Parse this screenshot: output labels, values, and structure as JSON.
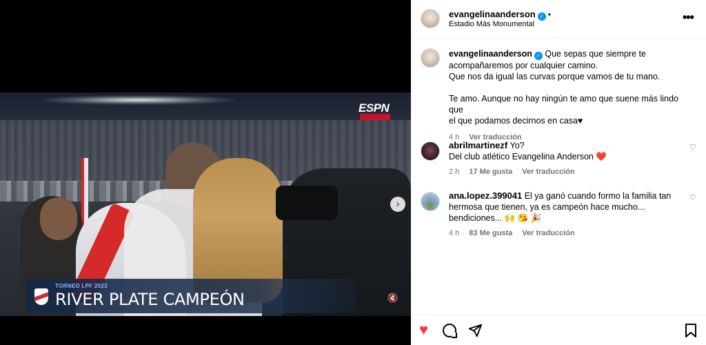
{
  "video": {
    "broadcaster": "ESPN",
    "tournament": "TORNEO LPF 2023",
    "headline": "RIVER PLATE CAMPEÓN"
  },
  "post": {
    "username": "evangelinaanderson",
    "location": "Estadio Más Monumental",
    "caption_lines": [
      "Que sepas que siempre te",
      "acompañaremos por cualquier camino.",
      "Que nos da igual las curvas porque vamos de tu mano.",
      "",
      "Te amo. Aunque no hay ningún te amo que suene más lindo que",
      "el que podamos decirnos en casa♥"
    ],
    "caption_time": "4 h",
    "caption_translate": "Ver traducción"
  },
  "comments": [
    {
      "username": "abrilmartinezf",
      "lines": [
        "Yo?",
        "Del club atlético Evangelina Anderson ❤️"
      ],
      "time": "2 h",
      "likes": "17 Me gusta",
      "translate": "Ver traducción"
    },
    {
      "username": "ana.lopez.399041",
      "lines": [
        "El ya ganó cuando formo la familia tan",
        "hermosa que tienen, ya es campeón hace mucho...",
        "bendiciones... 🙌 😘 🎉"
      ],
      "time": "4 h",
      "likes": "83 Me gusta",
      "translate": "Ver traducción"
    }
  ],
  "icons": {
    "more": "•••",
    "next": "›",
    "mute": "🔇",
    "like": "♥",
    "share": "➢",
    "bookmark": "🔖",
    "small_heart": "♡",
    "verified": "✓"
  },
  "colors": {
    "like_active": "#ff3040",
    "verified": "#0095f6",
    "muted_text": "#737373"
  }
}
